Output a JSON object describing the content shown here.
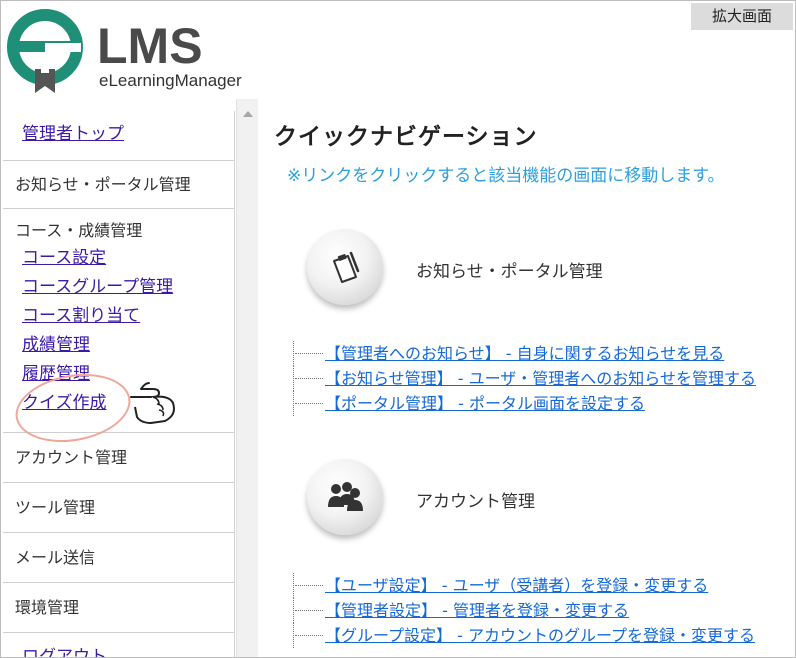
{
  "logo": {
    "brand": "LMS",
    "subtitle": "eLearningManager"
  },
  "zoom_badge": "拡大画面",
  "sidebar": {
    "admin_top": "管理者トップ",
    "notice_portal": "お知らせ・ポータル管理",
    "course_grade": {
      "heading": "コース・成績管理",
      "items": [
        "コース設定",
        "コースグループ管理",
        "コース割り当て",
        "成績管理",
        "履歴管理",
        "クイズ作成"
      ]
    },
    "account": "アカウント管理",
    "tools": "ツール管理",
    "mail": "メール送信",
    "environment": "環境管理",
    "logout": "ログアウト"
  },
  "main": {
    "title": "クイックナビゲーション",
    "note": "※リンクをクリックすると該当機能の画面に移動します。",
    "sections": [
      {
        "title": "お知らせ・ポータル管理",
        "icon": "clipboard-icon",
        "links": [
          "【管理者へのお知らせ】 - 自身に関するお知らせを見る",
          "【お知らせ管理】 - ユーザ・管理者へのお知らせを管理する",
          "【ポータル管理】 - ポータル画面を設定する"
        ]
      },
      {
        "title": "アカウント管理",
        "icon": "users-icon",
        "links": [
          "【ユーザ設定】 - ユーザ（受講者）を登録・変更する",
          "【管理者設定】 - 管理者を登録・変更する",
          "【グループ設定】 - アカウントのグループを登録・変更する"
        ]
      }
    ]
  },
  "colors": {
    "logo_green": "#1f8f77",
    "link": "#1569d6",
    "sidebar_link": "#3a1aa6",
    "note": "#2aa0e0",
    "annotation": "#f0a79a"
  }
}
